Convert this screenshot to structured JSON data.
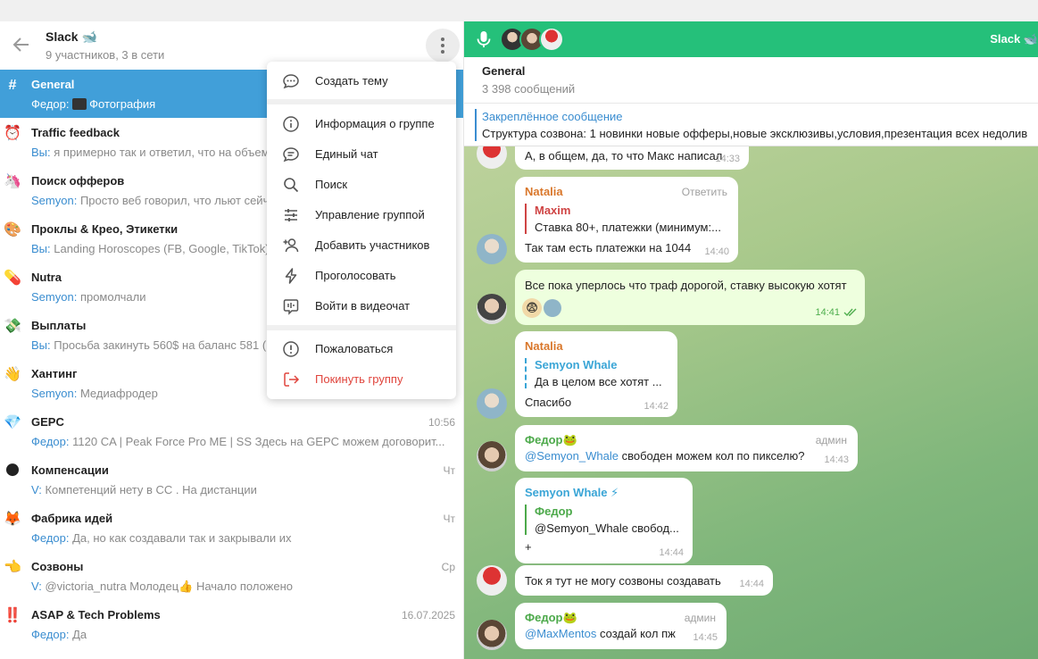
{
  "left_header": {
    "title": "Slack 🐋",
    "subtitle": "9 участников, 3 в сети"
  },
  "chats": [
    {
      "icon": "#",
      "name": "General",
      "who": "Федор:",
      "preview": "Фотография",
      "time": "",
      "active": true
    },
    {
      "icon": "⏰",
      "name": "Traffic feedback",
      "who": "Вы:",
      "preview": "я примерно так и ответил, что на объем",
      "time": ""
    },
    {
      "icon": "🦄",
      "name": "Поиск офферов",
      "who": "Semyon:",
      "preview": "Просто веб говорил, что льют сейчас",
      "time": ""
    },
    {
      "icon": "🎨",
      "name": "Проклы & Креo, Этикетки",
      "who": "Вы:",
      "preview": "Landing  Horoscopes (FB, Google, TikTok)",
      "time": ""
    },
    {
      "icon": "💊",
      "name": "Nutra",
      "who": "Semyon:",
      "preview": "промолчали",
      "time": ""
    },
    {
      "icon": "💸",
      "name": "Выплаты",
      "who": "Вы:",
      "preview": "Просьба закинуть 560$ на баланс 581 (",
      "time": ""
    },
    {
      "icon": "👋",
      "name": "Хантинг",
      "who": "Semyon:",
      "preview": "Медиафродер",
      "time": ""
    },
    {
      "icon": "💎",
      "name": "GEPC",
      "who": "Федор:",
      "preview": "1120 CA | Peak Force Pro ME | SS  Здесь на GEPC можем  договорит...",
      "time": "10:56"
    },
    {
      "icon": "🌑",
      "name": "Компенсации",
      "who": "V:",
      "preview": "Компетенций нету в СС . На дистанции",
      "time": "Чт"
    },
    {
      "icon": "🦊",
      "name": "Фабрика идей",
      "who": "Федор:",
      "preview": "Да, но как создавали так и закрывали их",
      "time": "Чт"
    },
    {
      "icon": "👈",
      "name": "Созвоны",
      "who": "V:",
      "preview": "@victoria_nutra Молодец👍 Начало положено",
      "time": "Ср"
    },
    {
      "icon": "‼️",
      "name": "ASAP & Tech Problems",
      "who": "Федор:",
      "preview": "Да",
      "time": "16.07.2025"
    }
  ],
  "menu": {
    "items": [
      {
        "label": "Создать тему",
        "icon": "chat-bubble-icon"
      },
      {
        "label": "Информация о группе",
        "icon": "info-icon"
      },
      {
        "label": "Единый чат",
        "icon": "single-chat-icon"
      },
      {
        "label": "Поиск",
        "icon": "search-icon"
      },
      {
        "label": "Управление группой",
        "icon": "sliders-icon"
      },
      {
        "label": "Добавить участников",
        "icon": "add-user-icon"
      },
      {
        "label": "Проголосовать",
        "icon": "lightning-icon"
      },
      {
        "label": "Войти в видеочат",
        "icon": "videochat-icon"
      },
      {
        "label": "Пожаловаться",
        "icon": "report-icon"
      },
      {
        "label": "Покинуть группу",
        "icon": "leave-icon"
      }
    ]
  },
  "call_bar": {
    "title": "Slack 🐋"
  },
  "chat_header": {
    "title": "General",
    "subtitle": "3 398 сообщений"
  },
  "pinned": {
    "title": "Закреплённое сообщение",
    "text": "Структура созвона:  1 новинки новые офферы,новые эксклюзивы,условия,презентация всех недолив"
  },
  "messages": [
    {
      "text": "А, в общем, да, то что Макс написал",
      "time": "14:33"
    },
    {
      "author": "Natalia",
      "reply": "Ответить",
      "quote_name": "Maxim",
      "quote_text": "Ставка 80+, платежки (минимум:...",
      "text": "Так там есть платежки на 1044",
      "time": "14:40"
    },
    {
      "text": "Все пока уперлось что траф дорогой, ставку высокую хотят",
      "time": "14:41"
    },
    {
      "author": "Natalia",
      "quote_name": "Semyon Whale",
      "quote_text": "Да в целом все хотят ...",
      "text": "Спасибо",
      "time": "14:42"
    },
    {
      "author": "Федор🐸",
      "role": "админ",
      "mention": "@Semyon_Whale",
      "text": " свободен можем кол по пикселю?",
      "time": "14:43"
    },
    {
      "author": "Semyon Whale ⚡",
      "quote_name": "Федор",
      "quote_text": "@Semyon_Whale свобод...",
      "text": "+",
      "time": "14:44"
    },
    {
      "text": "Ток я тут не могу созвоны создавать",
      "time": "14:44"
    },
    {
      "author": "Федор🐸",
      "role": "админ",
      "mention": "@MaxMentos",
      "text": " создай кол пж",
      "time": "14:45"
    }
  ],
  "colors": {
    "accent": "#419fd9",
    "call_green": "#25c07a",
    "natalia": "#d9772b",
    "fedor": "#4ca94a",
    "semyon": "#3aa5d6",
    "maxim": "#cf4444",
    "danger": "#e0453d"
  }
}
